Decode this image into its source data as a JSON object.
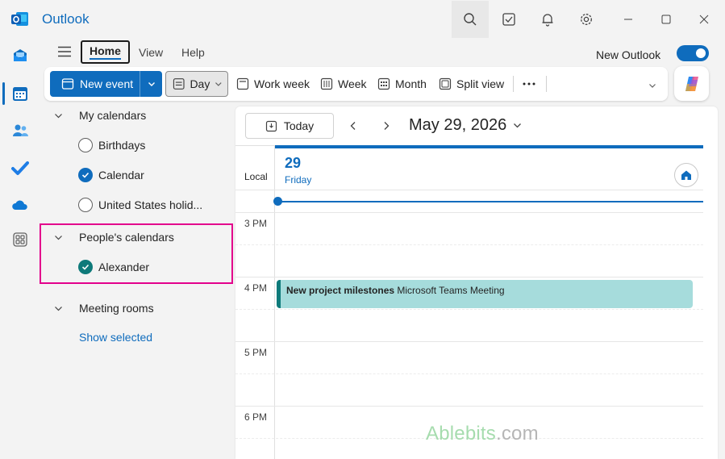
{
  "app": {
    "title": "Outlook"
  },
  "menu": {
    "tabs": [
      {
        "label": "Home",
        "active": true
      },
      {
        "label": "View",
        "active": false
      },
      {
        "label": "Help",
        "active": false
      }
    ],
    "new_outlook_label": "New Outlook",
    "new_outlook_enabled": true
  },
  "ribbon": {
    "new_event": "New event",
    "views": [
      "Day",
      "Work week",
      "Week",
      "Month",
      "Split view"
    ],
    "selected_view": "Day"
  },
  "folders": {
    "my_calendars": {
      "label": "My calendars",
      "items": [
        {
          "label": "Birthdays",
          "checked": false
        },
        {
          "label": "Calendar",
          "checked": true,
          "color": "#0f6cbd"
        },
        {
          "label": "United States holid...",
          "checked": false
        }
      ]
    },
    "peoples_calendars": {
      "label": "People's calendars",
      "items": [
        {
          "label": "Alexander",
          "checked": true,
          "color": "#0e7a7a"
        }
      ]
    },
    "meeting_rooms": {
      "label": "Meeting rooms"
    },
    "show_selected": "Show selected"
  },
  "calendar": {
    "today_label": "Today",
    "date_title": "May 29, 2026",
    "day_number": "29",
    "day_name": "Friday",
    "timezone_label": "Local",
    "time_labels": [
      "3 PM",
      "4 PM",
      "5 PM",
      "6 PM"
    ],
    "event": {
      "title": "New project milestones",
      "detail": "Microsoft Teams Meeting",
      "color": "#a6dcdc",
      "accent": "#0e7a7a"
    }
  },
  "colors": {
    "accent": "#0f6cbd",
    "highlight": "#e3008c"
  },
  "watermark": {
    "name": "Ablebits",
    "suffix": ".com"
  }
}
